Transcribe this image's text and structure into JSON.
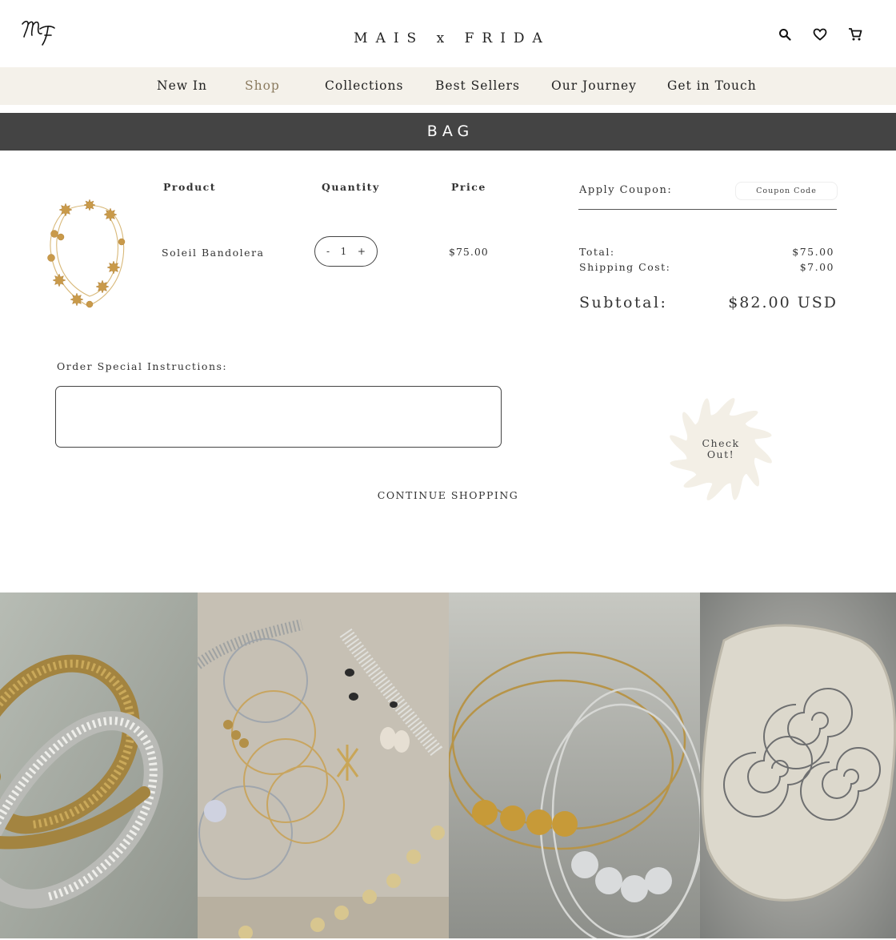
{
  "header": {
    "brand": "MAIS x FRIDA",
    "logo_icon": "mf-monogram-logo",
    "icons": [
      "search-icon",
      "heart-icon",
      "cart-icon"
    ]
  },
  "nav": {
    "items": [
      {
        "label": "New In"
      },
      {
        "label": "Shop",
        "active": true
      },
      {
        "label": "Collections"
      },
      {
        "label": "Best Sellers"
      },
      {
        "label": "Our Journey"
      },
      {
        "label": "Get in Touch"
      }
    ]
  },
  "banner": {
    "title": "BAG"
  },
  "cart": {
    "headers": {
      "product": "Product",
      "quantity": "Quantity",
      "price": "Price"
    },
    "items": [
      {
        "name": "Soleil Bandolera",
        "quantity": "1",
        "minus": "-",
        "plus": "+",
        "price": "$75.00"
      }
    ]
  },
  "summary": {
    "coupon_label": "Apply Coupon:",
    "coupon_placeholder": "Coupon Code",
    "total_label": "Total:",
    "total_value": "$75.00",
    "shipping_label": "Shipping Cost:",
    "shipping_value": "$7.00",
    "subtotal_label": "Subtotal:",
    "subtotal_value": "$82.00 USD"
  },
  "instructions": {
    "label": "Order Special Instructions:",
    "value": ""
  },
  "checkout": {
    "line1": "Check",
    "line2": "Out!"
  },
  "continue_label": "CONTINUE SHOPPING",
  "colors": {
    "nav_bg": "#f4f1ea",
    "banner_bg": "#444444",
    "active_nav": "#8a7a5e",
    "sun": "#f3efe6"
  }
}
